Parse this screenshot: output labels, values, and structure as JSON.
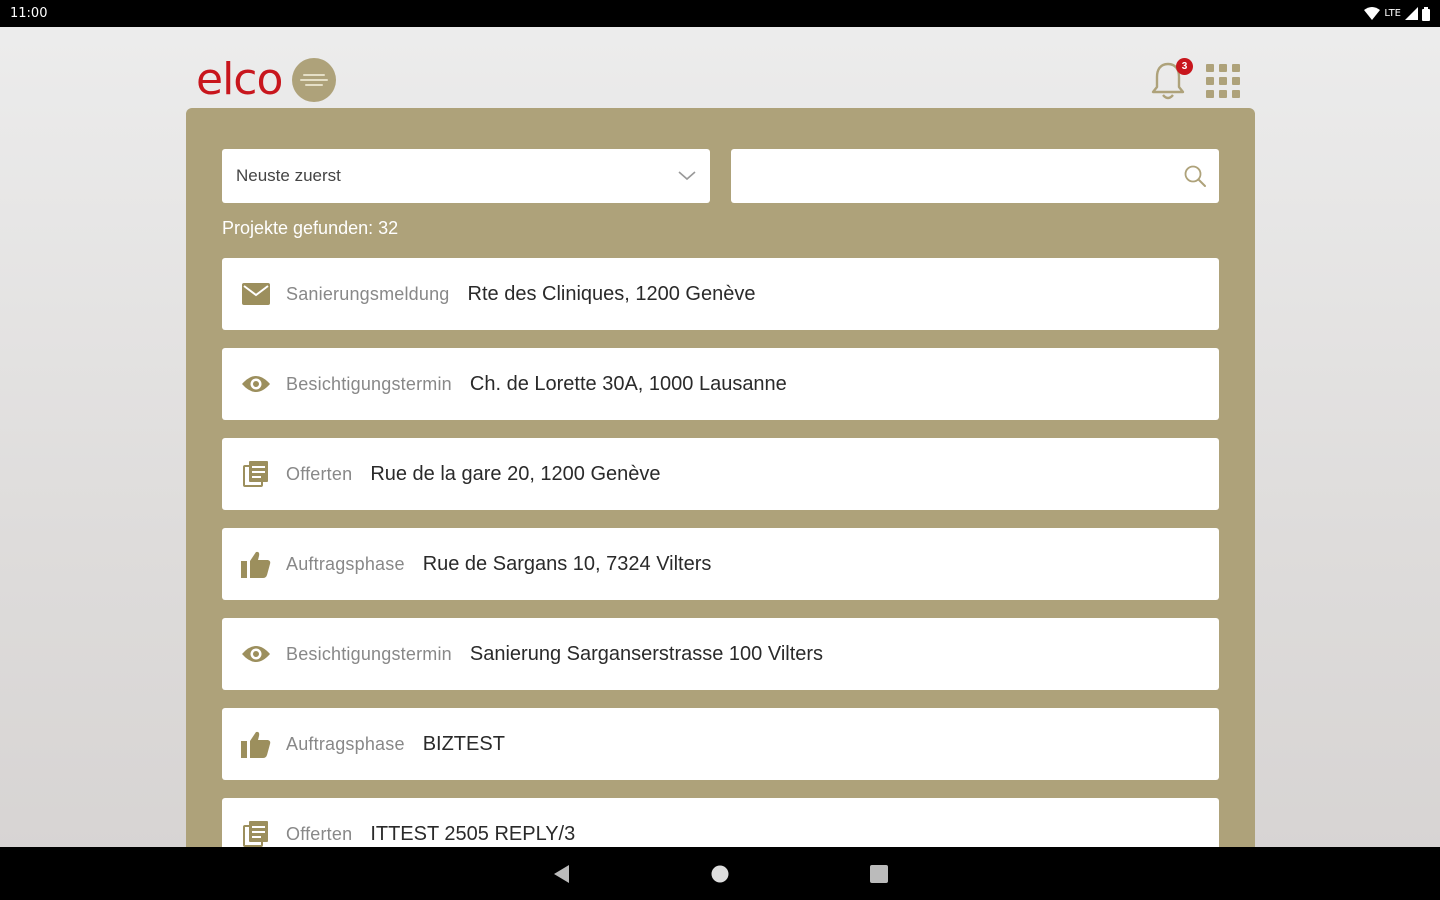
{
  "status_bar": {
    "time": "11:00",
    "network": "LTE"
  },
  "header": {
    "logo_text": "elco",
    "notification_count": "3"
  },
  "filters": {
    "sort_value": "Neuste zuerst",
    "search_value": "",
    "search_placeholder": ""
  },
  "results_label": "Projekte gefunden: 32",
  "projects": [
    {
      "icon": "envelope-icon",
      "phase": "Sanierungsmeldung",
      "title": "Rte des Cliniques, 1200 Genève"
    },
    {
      "icon": "eye-icon",
      "phase": "Besichtigungstermin",
      "title": "Ch. de Lorette 30A, 1000 Lausanne"
    },
    {
      "icon": "document-icon",
      "phase": "Offerten",
      "title": "Rue de la gare 20, 1200 Genève"
    },
    {
      "icon": "thumbs-up-icon",
      "phase": "Auftragsphase",
      "title": "Rue de Sargans 10, 7324 Vilters"
    },
    {
      "icon": "eye-icon",
      "phase": "Besichtigungstermin",
      "title": "Sanierung Sarganserstrasse 100 Vilters"
    },
    {
      "icon": "thumbs-up-icon",
      "phase": "Auftragsphase",
      "title": "BIZTEST"
    },
    {
      "icon": "document-icon",
      "phase": "Offerten",
      "title": "ITTEST 2505 REPLY/3"
    }
  ],
  "colors": {
    "accent": "#aea27a",
    "brand": "#c8161d",
    "icon": "#9c8f5d"
  }
}
